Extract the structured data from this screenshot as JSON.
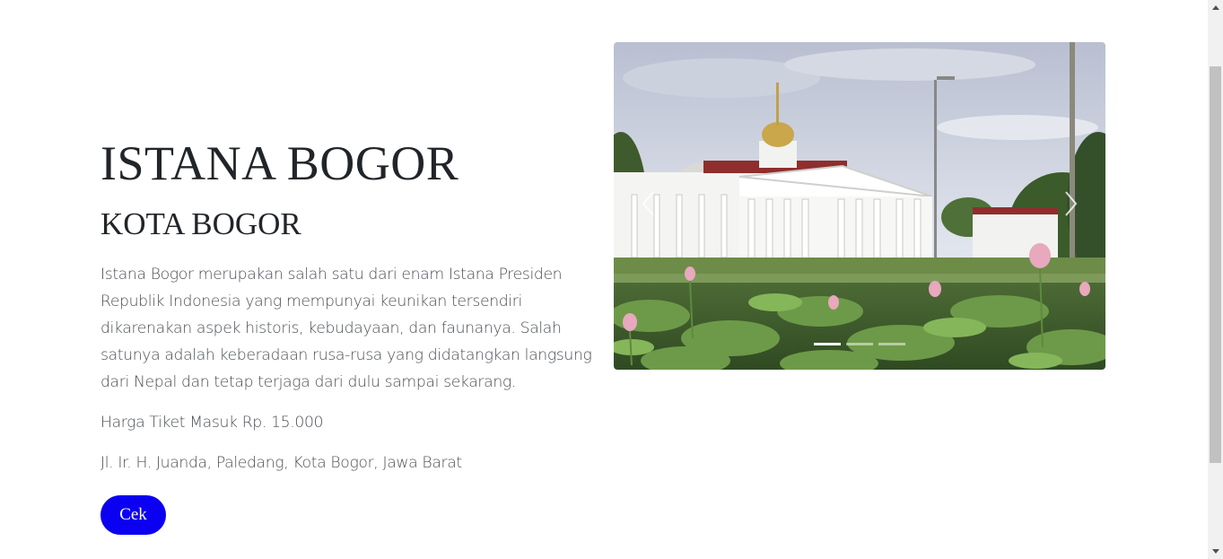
{
  "destination": {
    "title": "ISTANA BOGOR",
    "city": "KOTA BOGOR",
    "description": "Istana Bogor merupakan salah satu dari enam Istana Presiden Republik Indonesia yang mempunyai keunikan tersendiri dikarenakan aspek historis, kebudayaan, dan faunanya. Salah satunya adalah keberadaan rusa-rusa yang didatangkan langsung dari Nepal dan tetap terjaga dari dulu sampai sekarang.",
    "price": "Harga Tiket Masuk Rp. 15.000",
    "address": "Jl. Ir. H. Juanda, Paledang, Kota Bogor, Jawa Barat",
    "button_label": "Cek"
  },
  "carousel": {
    "slide_count": 3,
    "active_index": 0,
    "prev_icon": "chevron-left-icon",
    "next_icon": "chevron-right-icon"
  },
  "colors": {
    "button_bg": "#0b00f2",
    "button_text": "#ffffff",
    "heading": "#212529",
    "body_text": "#4a4f55"
  }
}
